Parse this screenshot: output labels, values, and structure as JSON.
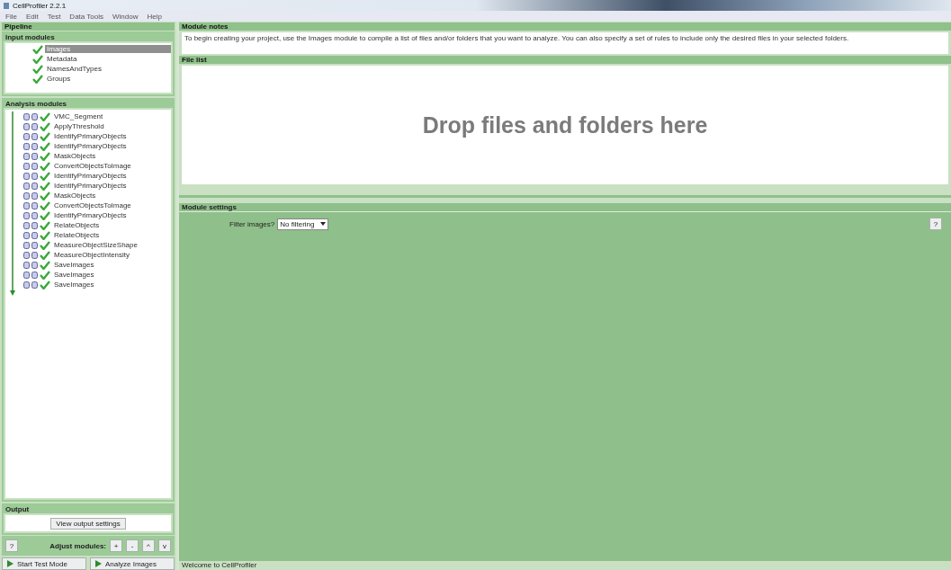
{
  "window": {
    "title": "CellProfiler 2.2.1"
  },
  "menu": [
    "File",
    "Edit",
    "Test",
    "Data Tools",
    "Window",
    "Help"
  ],
  "pipeline": {
    "title": "Pipeline",
    "input_modules": {
      "title": "Input modules",
      "items": [
        {
          "label": "Images",
          "selected": true
        },
        {
          "label": "Metadata",
          "selected": false
        },
        {
          "label": "NamesAndTypes",
          "selected": false
        },
        {
          "label": "Groups",
          "selected": false
        }
      ]
    },
    "analysis_modules": {
      "title": "Analysis modules",
      "items": [
        {
          "label": "VMC_Segment",
          "selected": false
        },
        {
          "label": "ApplyThreshold",
          "selected": false
        },
        {
          "label": "IdentifyPrimaryObjects",
          "selected": false
        },
        {
          "label": "IdentifyPrimaryObjects",
          "selected": false
        },
        {
          "label": "MaskObjects",
          "selected": false
        },
        {
          "label": "ConvertObjectsToImage",
          "selected": false
        },
        {
          "label": "IdentifyPrimaryObjects",
          "selected": false
        },
        {
          "label": "IdentifyPrimaryObjects",
          "selected": false
        },
        {
          "label": "MaskObjects",
          "selected": false
        },
        {
          "label": "ConvertObjectsToImage",
          "selected": false
        },
        {
          "label": "IdentifyPrimaryObjects",
          "selected": false
        },
        {
          "label": "RelateObjects",
          "selected": false
        },
        {
          "label": "RelateObjects",
          "selected": false
        },
        {
          "label": "MeasureObjectSizeShape",
          "selected": false
        },
        {
          "label": "MeasureObjectIntensity",
          "selected": false
        },
        {
          "label": "SaveImages",
          "selected": false
        },
        {
          "label": "SaveImages",
          "selected": false
        },
        {
          "label": "SaveImages",
          "selected": false
        }
      ]
    },
    "output": {
      "title": "Output",
      "button": "View output settings"
    },
    "adjust": {
      "help": "?",
      "label": "Adjust modules:",
      "buttons": [
        "+",
        "-",
        "^",
        "v"
      ]
    },
    "run_buttons": [
      "Start Test Mode",
      "Analyze Images"
    ]
  },
  "module_notes": {
    "title": "Module notes",
    "text": "To begin creating your project, use the Images module to compile a list of files and/or folders that you want to analyze. You can also specify a set of rules to include only the desired files in your selected folders."
  },
  "file_list": {
    "title": "File list",
    "drop_text": "Drop files and folders here"
  },
  "module_settings": {
    "title": "Module settings",
    "filter_label": "Filter images?",
    "filter_value": "No filtering",
    "help": "?"
  },
  "status_bar": "Welcome to CellProfiler"
}
